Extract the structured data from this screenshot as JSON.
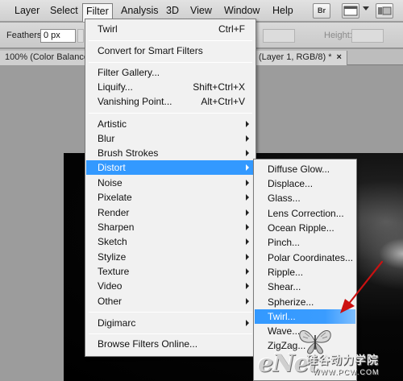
{
  "menubar": {
    "items": [
      "Layer",
      "Select",
      "Filter",
      "Analysis",
      "3D",
      "View",
      "Window",
      "Help"
    ],
    "active": "Filter",
    "br_badge": "Br",
    "icon_window": "window-icon",
    "icon_dropdown": "chevron-down-icon"
  },
  "options_bar": {
    "feather_label": "Feathers:",
    "feather_value": "0 px",
    "height_label": "Height:"
  },
  "tabs": {
    "left": "100% (Color Balance",
    "right": "(Layer 1, RGB/8) *",
    "close_glyph": "×"
  },
  "filter_menu": {
    "last_filter": {
      "label": "Twirl",
      "shortcut": "Ctrl+F"
    },
    "smart": "Convert for Smart Filters",
    "group2": [
      {
        "label": "Filter Gallery...",
        "shortcut": ""
      },
      {
        "label": "Liquify...",
        "shortcut": "Shift+Ctrl+X"
      },
      {
        "label": "Vanishing Point...",
        "shortcut": "Alt+Ctrl+V"
      }
    ],
    "categories": [
      "Artistic",
      "Blur",
      "Brush Strokes",
      "Distort",
      "Noise",
      "Pixelate",
      "Render",
      "Sharpen",
      "Sketch",
      "Stylize",
      "Texture",
      "Video",
      "Other"
    ],
    "highlighted": "Distort",
    "digimarc": "Digimarc",
    "browse": "Browse Filters Online..."
  },
  "distort_submenu": {
    "items": [
      "Diffuse Glow...",
      "Displace...",
      "Glass...",
      "Lens Correction...",
      "Ocean Ripple...",
      "Pinch...",
      "Polar Coordinates...",
      "Ripple...",
      "Shear...",
      "Spherize...",
      "Twirl...",
      "Wave...",
      "ZigZag..."
    ],
    "highlighted": "Twirl..."
  },
  "watermark": {
    "logo": "eNet",
    "chinese": "硅谷动力学院",
    "url": "WWW.PCW.COM"
  },
  "colors": {
    "highlight": "#3399ff",
    "arrow": "#cc1111"
  }
}
